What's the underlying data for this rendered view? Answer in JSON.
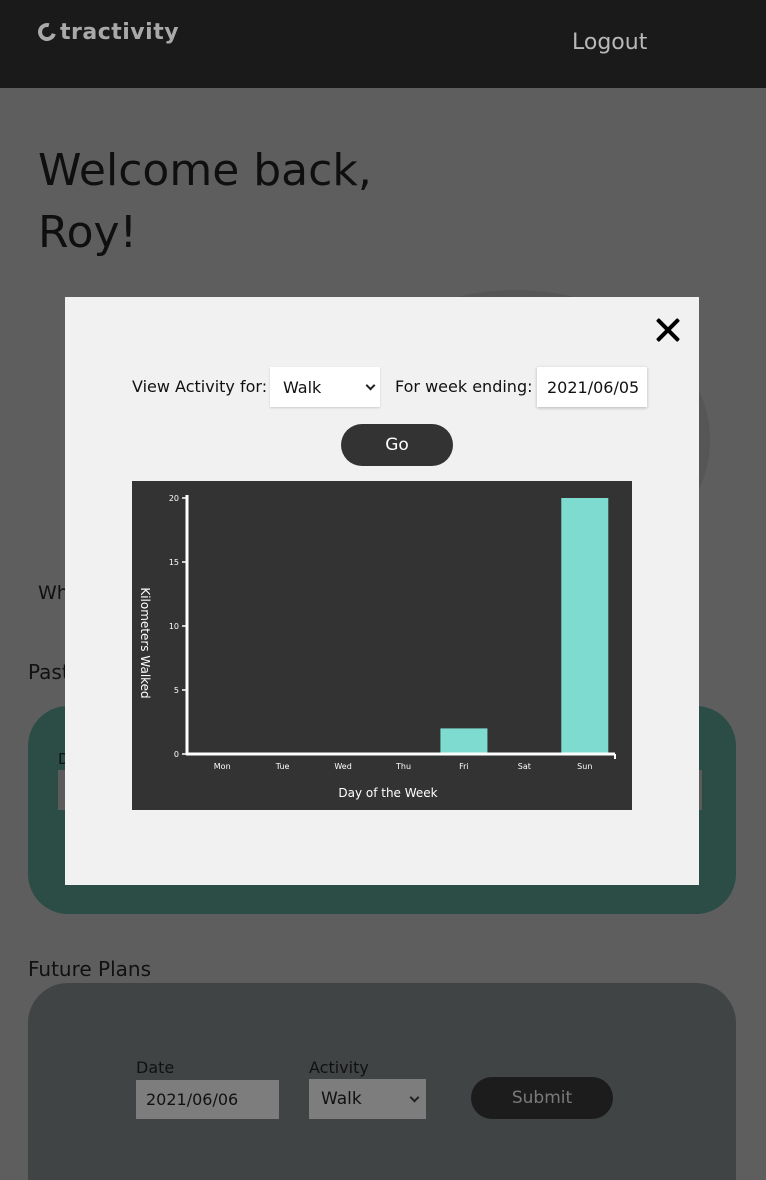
{
  "header": {
    "logo_text": "tractivity",
    "logout_label": "Logout"
  },
  "welcome": {
    "line1": "Welcome back,",
    "line2": "Roy!"
  },
  "background": {
    "fragment_wh": "Wh",
    "fragment_past": "Past",
    "fragment_d": "D"
  },
  "future": {
    "title": "Future Plans",
    "date_label": "Date",
    "date_value": "2021/06/06",
    "activity_label": "Activity",
    "activity_value": "Walk",
    "submit_label": "Submit"
  },
  "modal": {
    "view_label": "View Activity for:",
    "activity_value": "Walk",
    "week_label": "For week ending:",
    "week_value": "2021/06/05",
    "go_label": "Go"
  },
  "colors": {
    "bar": "#7ddccf",
    "axis": "#ffffff",
    "chart_bg": "#333333"
  },
  "chart_data": {
    "type": "bar",
    "categories": [
      "Mon",
      "Tue",
      "Wed",
      "Thu",
      "Fri",
      "Sat",
      "Sun"
    ],
    "values": [
      0,
      0,
      0,
      0,
      2,
      0,
      20
    ],
    "xlabel": "Day of the Week",
    "ylabel": "Kilometers Walked",
    "ylim": [
      0,
      20
    ],
    "yticks": [
      0,
      5,
      10,
      15,
      20
    ],
    "grid": false
  }
}
